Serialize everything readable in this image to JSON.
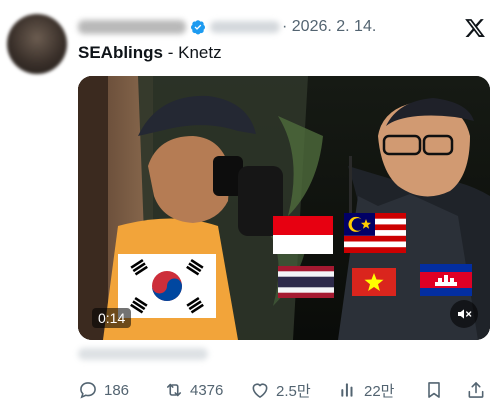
{
  "tweet": {
    "date": "· 2026. 2. 14.",
    "text_bold": "SEAblings",
    "text_rest": " - Knetz"
  },
  "video": {
    "elapsed": "0:14"
  },
  "actions": {
    "replies": "186",
    "reposts": "4376",
    "likes": "2.5만",
    "views": "22만"
  },
  "colors": {
    "verified": "#1d9bf0",
    "muted_text": "#536471"
  },
  "icons": [
    "x-logo-icon",
    "verified-icon",
    "reply-icon",
    "repost-icon",
    "like-icon",
    "views-icon",
    "bookmark-icon",
    "share-icon",
    "mute-icon"
  ]
}
